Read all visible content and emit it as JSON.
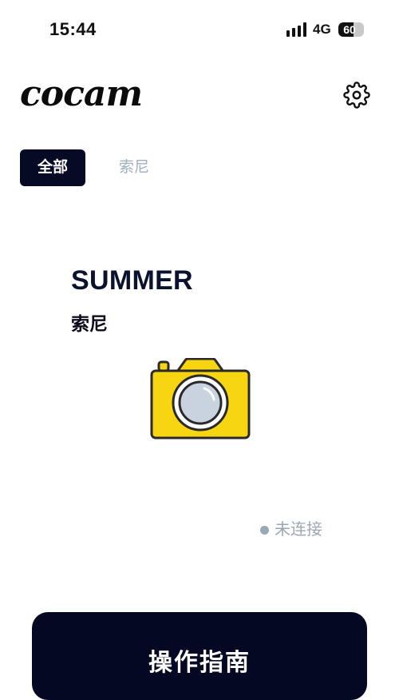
{
  "status_bar": {
    "time": "15:44",
    "network": "4G",
    "battery_level": "60",
    "battery_fraction": 0.6
  },
  "header": {
    "logo": "cocam",
    "settings_icon": "gear-icon"
  },
  "tabs": [
    {
      "label": "全部",
      "active": true
    },
    {
      "label": "索尼",
      "active": false
    }
  ],
  "device": {
    "name": "SUMMER",
    "brand": "索尼",
    "icon": "camera-icon",
    "status": "未连接"
  },
  "guide_button": {
    "label": "操作指南"
  },
  "colors": {
    "primary_dark": "#070a24",
    "muted": "#9aa8b5",
    "camera_yellow": "#f7d611"
  }
}
